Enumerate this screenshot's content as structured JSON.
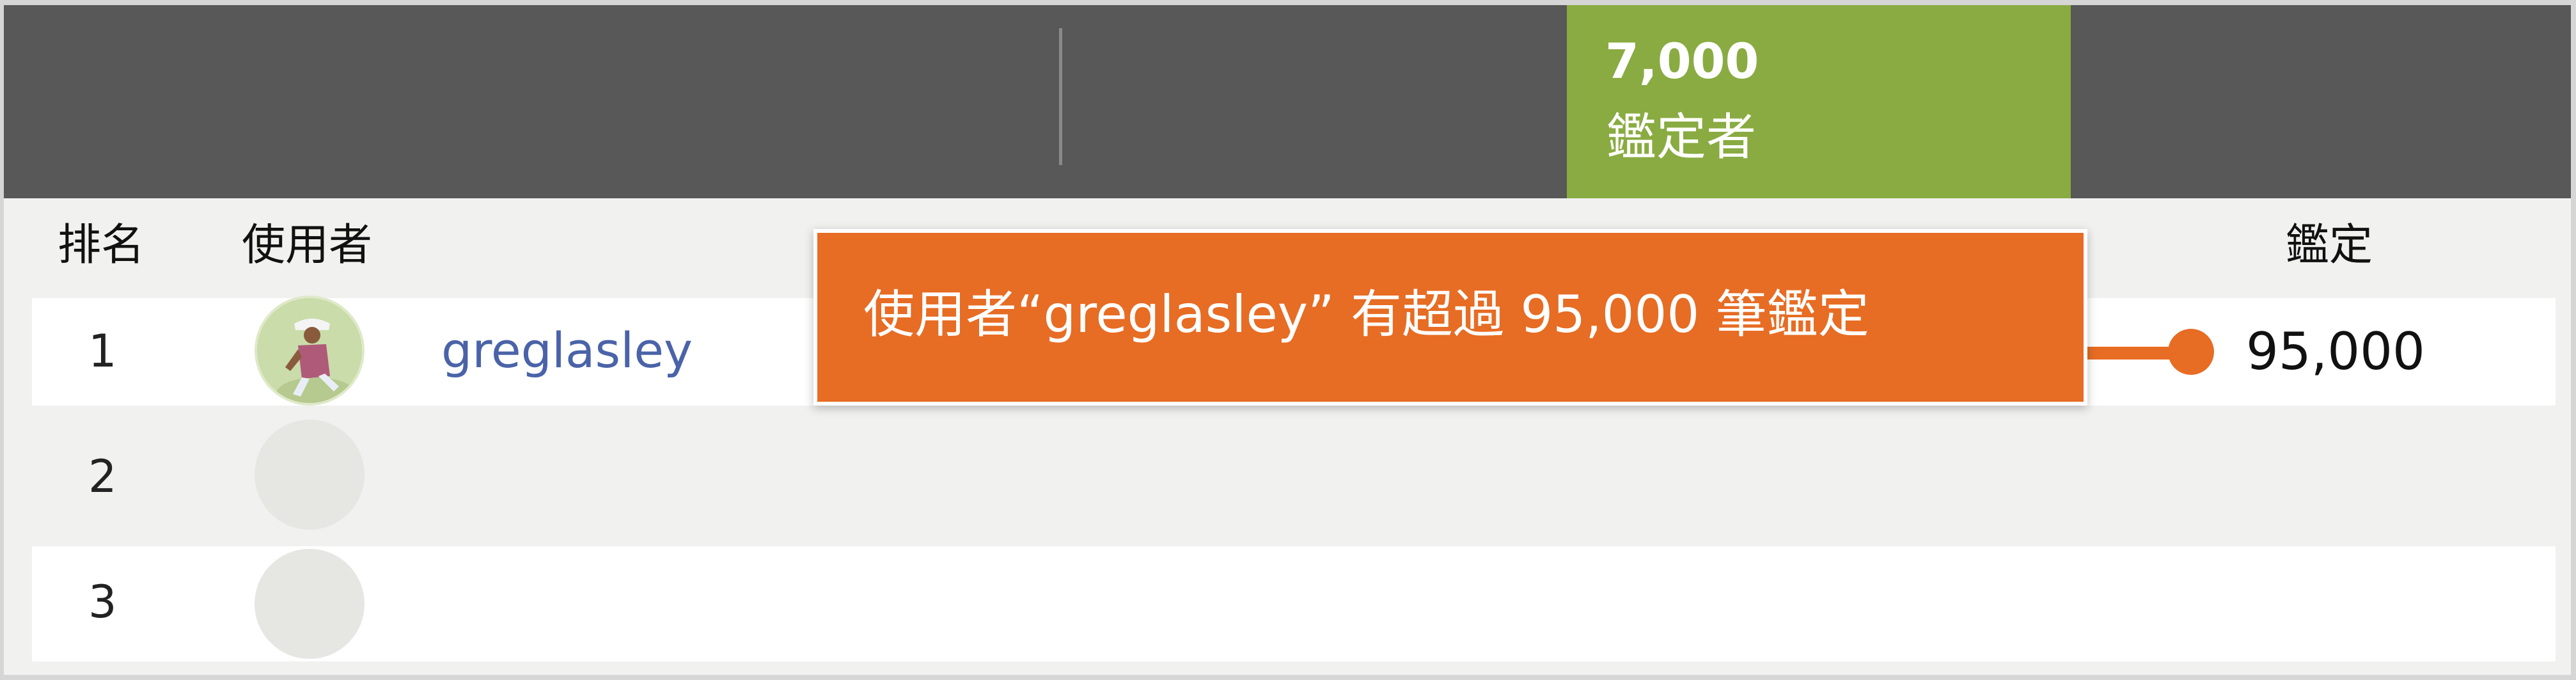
{
  "stats": {
    "count": "7,000",
    "label": "鑑定者"
  },
  "table": {
    "headers": {
      "rank": "排名",
      "user": "使用者",
      "identifications": "鑑定"
    },
    "rows": [
      {
        "rank": "1",
        "username": "greglasley",
        "count": "95,000"
      },
      {
        "rank": "2",
        "username": "",
        "count": ""
      },
      {
        "rank": "3",
        "username": "",
        "count": ""
      }
    ]
  },
  "callout": {
    "text": "使用者“greglasley” 有超過 95,000 筆鑑定"
  },
  "colors": {
    "topbar": "#575857",
    "stat_box": "#89ab41",
    "accent": "#e76c24",
    "link": "#4a63a8"
  }
}
